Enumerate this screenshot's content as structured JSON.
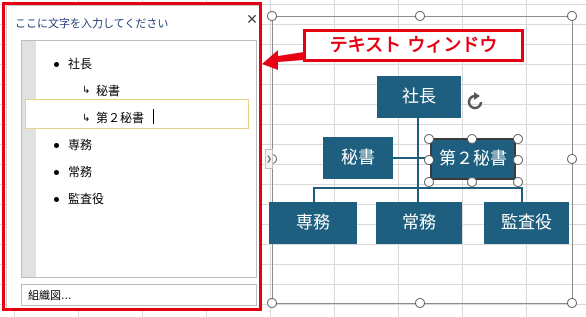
{
  "text_pane": {
    "title": "ここに文字を入力してください",
    "close_icon": "close-icon",
    "items": [
      {
        "label": "社長",
        "level": 1
      },
      {
        "label": "秘書",
        "level": 2
      },
      {
        "label": "第２秘書",
        "level": 2
      },
      {
        "label": "専務",
        "level": 1
      },
      {
        "label": "常務",
        "level": 1
      },
      {
        "label": "監査役",
        "level": 1
      }
    ],
    "footer": "組織図..."
  },
  "callout": {
    "label": "テキスト ウィンドウ",
    "color": "#e60012"
  },
  "org_chart": {
    "fill_color": "#1e5f7f",
    "top": "社長",
    "assistants": [
      "秘書",
      "第２秘書"
    ],
    "subordinates": [
      "専務",
      "常務",
      "監査役"
    ]
  }
}
